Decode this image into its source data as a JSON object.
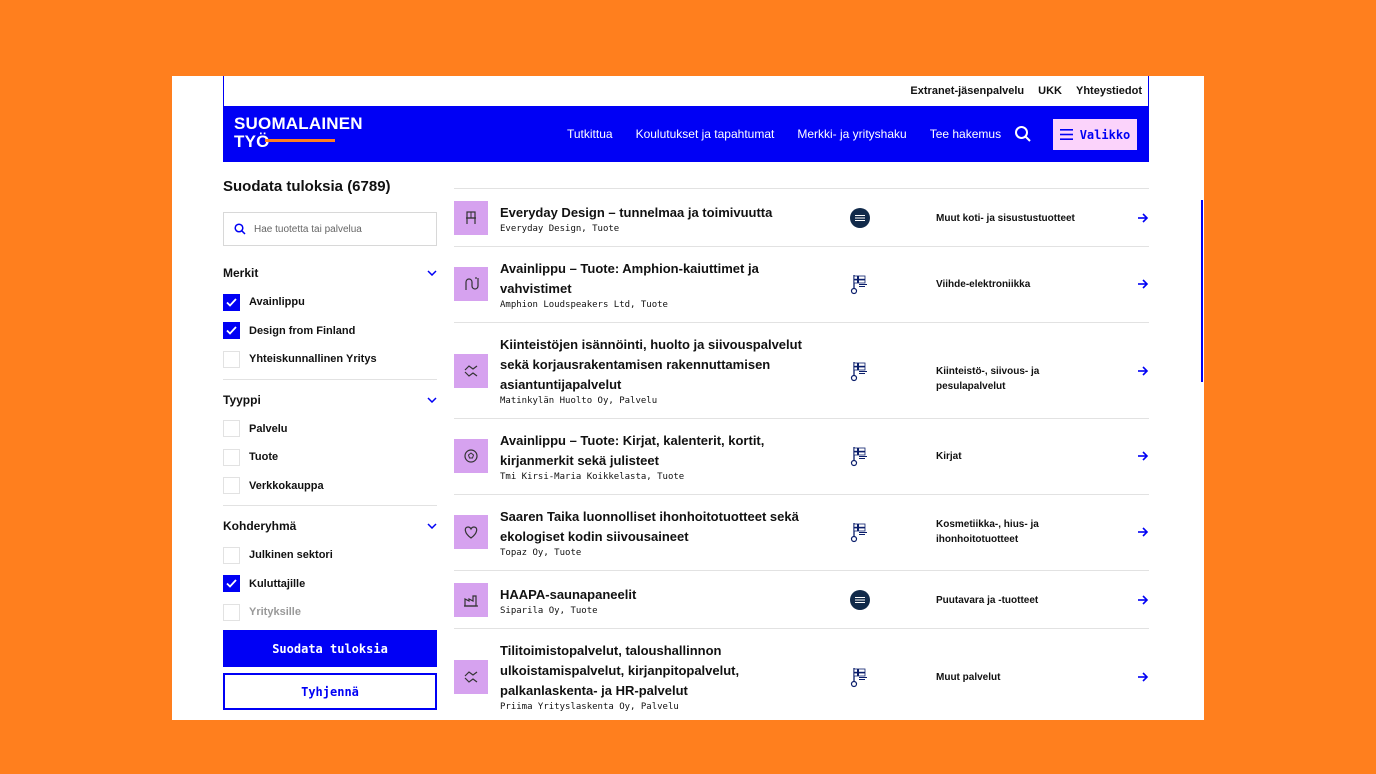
{
  "topbar": {
    "links": [
      "Extranet-jäsenpalvelu",
      "UKK",
      "Yhteystiedot"
    ]
  },
  "nav": {
    "logo_line1": "SUOMALAINEN",
    "logo_line2": "TYÖ",
    "links": [
      "Tutkittua",
      "Koulutukset ja tapahtumat",
      "Merkki- ja yrityshaku",
      "Tee hakemus"
    ],
    "menu_label": "Valikko"
  },
  "sidebar": {
    "title": "Suodata tuloksia (6789)",
    "search_placeholder": "Hae tuotetta tai palvelua",
    "groups": [
      {
        "title": "Merkit",
        "options": [
          {
            "label": "Avainlippu",
            "checked": true
          },
          {
            "label": "Design from Finland",
            "checked": true
          },
          {
            "label": "Yhteiskunnallinen Yritys",
            "checked": false
          }
        ]
      },
      {
        "title": "Tyyppi",
        "options": [
          {
            "label": "Palvelu",
            "checked": false
          },
          {
            "label": "Tuote",
            "checked": false
          },
          {
            "label": "Verkkokauppa",
            "checked": false
          }
        ]
      },
      {
        "title": "Kohderyhmä",
        "options": [
          {
            "label": "Julkinen sektori",
            "checked": false
          },
          {
            "label": "Kuluttajille",
            "checked": true
          },
          {
            "label": "Yrityksille",
            "checked": false,
            "muted": true
          }
        ]
      }
    ],
    "filter_button": "Suodata tuloksia",
    "clear_button": "Tyhjennä"
  },
  "results": [
    {
      "title": "Everyday Design – tunnelmaa ja toimivuutta",
      "subtitle": "Everyday Design, Tuote",
      "category": "Muut koti- ja sisustustuotteet",
      "mark": "design-from-finland",
      "icon": "chair-icon"
    },
    {
      "title": "Avainlippu – Tuote: Amphion-kaiuttimet ja vahvistimet",
      "subtitle": "Amphion Loudspeakers Ltd, Tuote",
      "category": "Viihde-elektroniikka",
      "mark": "avainlippu",
      "icon": "cable-icon"
    },
    {
      "title": "Kiinteistöjen isännöinti, huolto ja siivouspalvelut sekä korjausrakentamisen rakennuttamisen asiantuntijapalvelut",
      "subtitle": "Matinkylän Huolto Oy, Palvelu",
      "category": "Kiinteistö-, siivous- ja pesulapalvelut",
      "mark": "avainlippu",
      "icon": "handshake-icon"
    },
    {
      "title": "Avainlippu – Tuote: Kirjat, kalenterit, kortit, kirjanmerkit sekä julisteet",
      "subtitle": "Tmi Kirsi-Maria Koikkelasta, Tuote",
      "category": "Kirjat",
      "mark": "avainlippu",
      "icon": "ball-icon"
    },
    {
      "title": "Saaren Taika luonnolliset ihonhoitotuotteet sekä ekologiset kodin siivousaineet",
      "subtitle": "Topaz Oy, Tuote",
      "category": "Kosmetiikka-, hius- ja ihonhoitotuotteet",
      "mark": "avainlippu",
      "icon": "heart-icon"
    },
    {
      "title": "HAAPA-saunapaneelit",
      "subtitle": "Siparila Oy, Tuote",
      "category": "Puutavara ja -tuotteet",
      "mark": "design-from-finland",
      "icon": "factory-icon"
    },
    {
      "title": "Tilitoimistopalvelut, taloushallinnon ulkoistamispalvelut, kirjanpitopalvelut, palkanlaskenta- ja HR-palvelut",
      "subtitle": "Priima Yrityslaskenta Oy, Palvelu",
      "category": "Muut palvelut",
      "mark": "avainlippu",
      "icon": "handshake-icon"
    }
  ],
  "colors": {
    "background": "#FF7F1E",
    "brand_blue": "#0000F5",
    "menu_pink": "#FBD3FB",
    "thumb_purple": "#D6A2EF",
    "dff_navy": "#112A4A"
  }
}
